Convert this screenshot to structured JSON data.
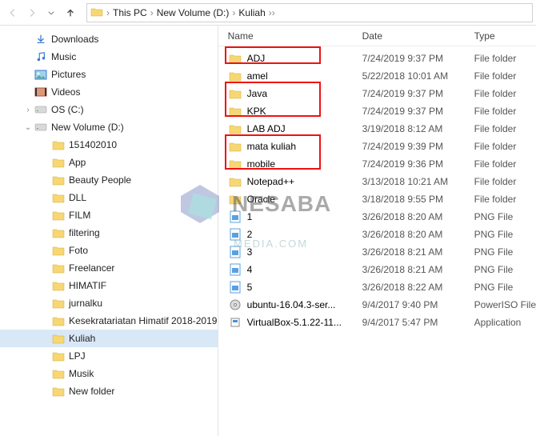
{
  "breadcrumb": [
    "This PC",
    "New Volume (D:)",
    "Kuliah"
  ],
  "sidebar": [
    {
      "indent": 28,
      "tw": "",
      "icon": "download",
      "label": "Downloads"
    },
    {
      "indent": 28,
      "tw": "",
      "icon": "music",
      "label": "Music"
    },
    {
      "indent": 28,
      "tw": "",
      "icon": "pictures",
      "label": "Pictures"
    },
    {
      "indent": 28,
      "tw": "",
      "icon": "videos",
      "label": "Videos"
    },
    {
      "indent": 28,
      "tw": ">",
      "icon": "drive",
      "label": "OS (C:)"
    },
    {
      "indent": 28,
      "tw": "v",
      "icon": "drive",
      "label": "New Volume (D:)"
    },
    {
      "indent": 50,
      "tw": "",
      "icon": "folder",
      "label": "151402010"
    },
    {
      "indent": 50,
      "tw": "",
      "icon": "folder",
      "label": "App"
    },
    {
      "indent": 50,
      "tw": "",
      "icon": "folder",
      "label": "Beauty People"
    },
    {
      "indent": 50,
      "tw": "",
      "icon": "folder",
      "label": "DLL"
    },
    {
      "indent": 50,
      "tw": "",
      "icon": "folder",
      "label": "FILM"
    },
    {
      "indent": 50,
      "tw": "",
      "icon": "folder",
      "label": "filtering"
    },
    {
      "indent": 50,
      "tw": "",
      "icon": "folder",
      "label": "Foto"
    },
    {
      "indent": 50,
      "tw": "",
      "icon": "folder",
      "label": "Freelancer"
    },
    {
      "indent": 50,
      "tw": "",
      "icon": "folder",
      "label": "HIMATIF"
    },
    {
      "indent": 50,
      "tw": "",
      "icon": "folder",
      "label": "jurnalku"
    },
    {
      "indent": 50,
      "tw": "",
      "icon": "folder",
      "label": "Kesekratariatan Himatif 2018-2019"
    },
    {
      "indent": 50,
      "tw": "",
      "icon": "folder",
      "label": "Kuliah",
      "selected": true
    },
    {
      "indent": 50,
      "tw": "",
      "icon": "folder",
      "label": "LPJ"
    },
    {
      "indent": 50,
      "tw": "",
      "icon": "folder",
      "label": "Musik"
    },
    {
      "indent": 50,
      "tw": "",
      "icon": "folder",
      "label": "New folder"
    }
  ],
  "columns": {
    "name": "Name",
    "date": "Date",
    "type": "Type"
  },
  "files": [
    {
      "icon": "folder",
      "name": "ADJ",
      "date": "7/24/2019 9:37 PM",
      "type": "File folder",
      "hl": 1
    },
    {
      "icon": "folder",
      "name": "amel",
      "date": "5/22/2018 10:01 AM",
      "type": "File folder"
    },
    {
      "icon": "folder",
      "name": "Java",
      "date": "7/24/2019 9:37 PM",
      "type": "File folder",
      "hl": 2
    },
    {
      "icon": "folder",
      "name": "KPK",
      "date": "7/24/2019 9:37 PM",
      "type": "File folder",
      "hl": 2
    },
    {
      "icon": "folder",
      "name": "LAB ADJ",
      "date": "3/19/2018 8:12 AM",
      "type": "File folder"
    },
    {
      "icon": "folder",
      "name": "mata kuliah",
      "date": "7/24/2019 9:39 PM",
      "type": "File folder",
      "hl": 3
    },
    {
      "icon": "folder",
      "name": "mobile",
      "date": "7/24/2019 9:36 PM",
      "type": "File folder",
      "hl": 3
    },
    {
      "icon": "folder",
      "name": "Notepad++",
      "date": "3/13/2018 10:21 AM",
      "type": "File folder"
    },
    {
      "icon": "folder",
      "name": "Oracle",
      "date": "3/18/2018 9:55 PM",
      "type": "File folder"
    },
    {
      "icon": "png",
      "name": "1",
      "date": "3/26/2018 8:20 AM",
      "type": "PNG File"
    },
    {
      "icon": "png",
      "name": "2",
      "date": "3/26/2018 8:20 AM",
      "type": "PNG File"
    },
    {
      "icon": "png",
      "name": "3",
      "date": "3/26/2018 8:21 AM",
      "type": "PNG File"
    },
    {
      "icon": "png",
      "name": "4",
      "date": "3/26/2018 8:21 AM",
      "type": "PNG File"
    },
    {
      "icon": "png",
      "name": "5",
      "date": "3/26/2018 8:22 AM",
      "type": "PNG File"
    },
    {
      "icon": "iso",
      "name": "ubuntu-16.04.3-ser...",
      "date": "9/4/2017 9:40 PM",
      "type": "PowerISO File"
    },
    {
      "icon": "exe",
      "name": "VirtualBox-5.1.22-11...",
      "date": "9/4/2017 5:47 PM",
      "type": "Application"
    }
  ],
  "watermark": {
    "line1": "NESABA",
    "line2": "MEDIA.COM"
  }
}
